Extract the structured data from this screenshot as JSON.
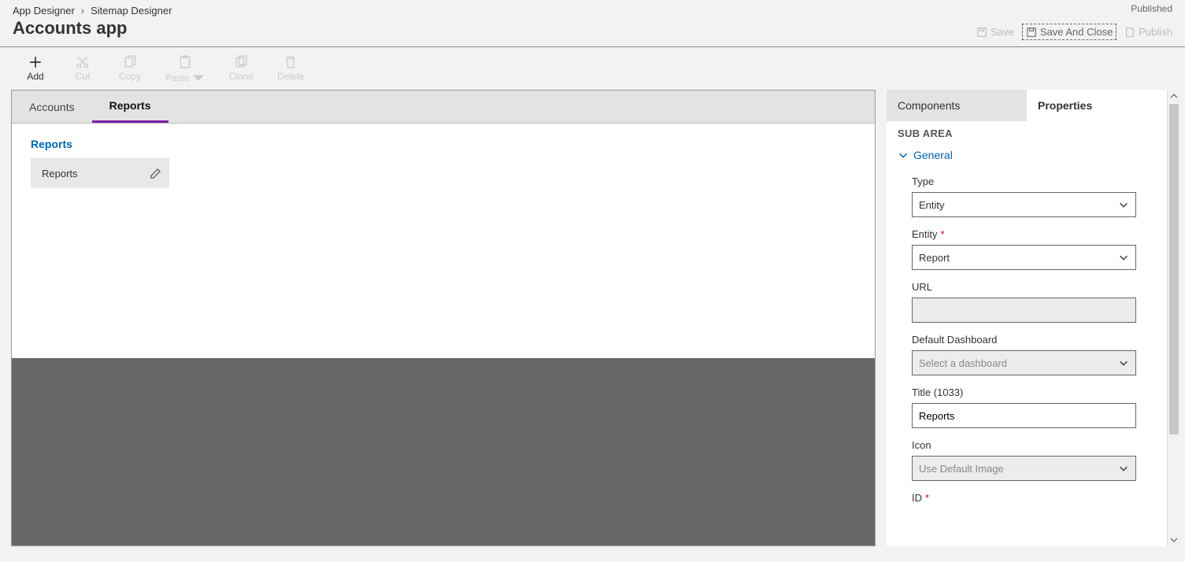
{
  "breadcrumb": {
    "root": "App Designer",
    "current": "Sitemap Designer"
  },
  "app_title": "Accounts app",
  "status": "Published",
  "header_actions": {
    "save": "Save",
    "save_close": "Save And Close",
    "publish": "Publish"
  },
  "toolbar": {
    "add": "Add",
    "cut": "Cut",
    "copy": "Copy",
    "paste": "Paste",
    "clone": "Clone",
    "delete": "Delete"
  },
  "tabs": [
    "Accounts",
    "Reports"
  ],
  "active_tab": "Reports",
  "group": {
    "title": "Reports",
    "item": "Reports"
  },
  "side_tabs": {
    "components": "Components",
    "properties": "Properties"
  },
  "section_label": "SUB AREA",
  "general_section": "General",
  "properties": {
    "type": {
      "label": "Type",
      "value": "Entity"
    },
    "entity": {
      "label": "Entity",
      "value": "Report"
    },
    "url": {
      "label": "URL",
      "value": ""
    },
    "dashboard": {
      "label": "Default Dashboard",
      "placeholder": "Select a dashboard"
    },
    "title": {
      "label": "Title (1033)",
      "value": "Reports"
    },
    "icon": {
      "label": "Icon",
      "value": "Use Default Image"
    },
    "id": {
      "label": "ID"
    }
  }
}
